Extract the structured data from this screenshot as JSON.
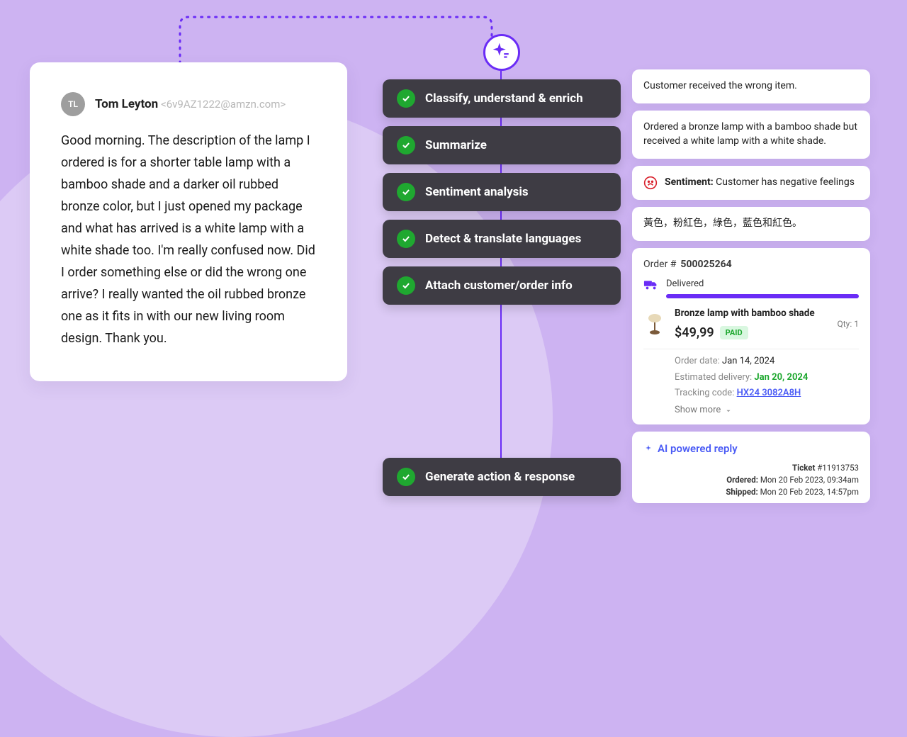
{
  "email": {
    "avatar_initials": "TL",
    "sender_name": "Tom Leyton",
    "sender_email": "<6v9AZ1222@amzn.com>",
    "body": "Good morning. The description of the lamp I ordered is for a shorter table lamp with a bamboo shade and a darker oil rubbed bronze color, but I just opened my package and what has arrived is a white lamp with a white shade too. I'm really confused now. Did I order something else or did the wrong one arrive? I really wanted the oil rubbed bronze one as it fits in with our new living room design. Thank you."
  },
  "workflow": {
    "steps": [
      "Classify, understand & enrich",
      "Summarize",
      "Sentiment analysis",
      "Detect & translate languages",
      "Attach customer/order info"
    ],
    "final_step": "Generate action & response"
  },
  "results": {
    "classify": "Customer received the wrong item.",
    "summary": "Ordered a bronze lamp with a bamboo shade but received a white lamp with a white shade.",
    "sentiment_label": "Sentiment:",
    "sentiment_text": " Customer has negative feelings",
    "translate": "黃色，粉紅色，綠色，藍色和紅色。"
  },
  "order": {
    "label": "Order #",
    "number": "500025264",
    "status": "Delivered",
    "item_name": "Bronze lamp with bamboo shade",
    "qty_label": "Qty: 1",
    "price": "$49,99",
    "paid": "PAID",
    "date_label": "Order date:",
    "date": "Jan 14, 2024",
    "eta_label": "Estimated delivery:",
    "eta": "Jan 20, 2024",
    "track_label": "Tracking code:",
    "track": "HX24 3082A8H",
    "show_more": "Show more"
  },
  "reply": {
    "title": "AI powered reply",
    "ticket_label": "Ticket",
    "ticket_no": "#11913753",
    "ordered_label": "Ordered:",
    "ordered": "Mon 20 Feb 2023, 09:34am",
    "shipped_label": "Shipped:",
    "shipped": "Mon 20 Feb 2023, 14:57pm"
  }
}
